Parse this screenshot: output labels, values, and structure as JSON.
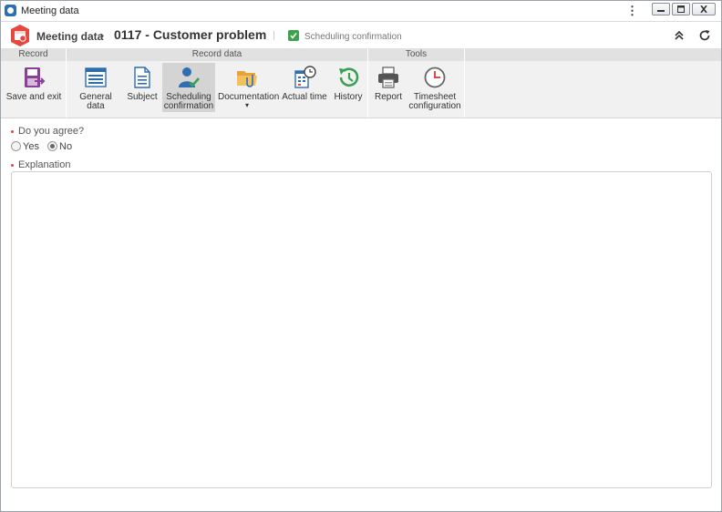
{
  "window": {
    "title": "Meeting data"
  },
  "header": {
    "module": "Meeting data",
    "separator": "›",
    "record": "0117 - Customer problem",
    "status": "Scheduling confirmation"
  },
  "ribbon": {
    "groups": [
      {
        "title": "Record"
      },
      {
        "title": "Record data"
      },
      {
        "title": "Tools"
      }
    ],
    "buttons": {
      "save_exit": {
        "line1": "Save and exit",
        "line2": ""
      },
      "general": {
        "line1": "General data",
        "line2": ""
      },
      "subject": {
        "line1": "Subject",
        "line2": ""
      },
      "scheduling": {
        "line1": "Scheduling",
        "line2": "confirmation"
      },
      "documentation": {
        "line1": "Documentation",
        "line2": "▾"
      },
      "actual_time": {
        "line1": "Actual time",
        "line2": ""
      },
      "history": {
        "line1": "History",
        "line2": ""
      },
      "report": {
        "line1": "Report",
        "line2": ""
      },
      "timesheet": {
        "line1": "Timesheet",
        "line2": "configuration"
      }
    }
  },
  "form": {
    "question_label": "Do you agree?",
    "options": [
      {
        "label": "Yes",
        "selected": false
      },
      {
        "label": "No",
        "selected": true
      }
    ],
    "explanation_label": "Explanation",
    "explanation_value": ""
  },
  "colors": {
    "accent_red": "#e5483f",
    "status_green": "#3da34a",
    "icon_blue": "#2f6db3",
    "icon_purple": "#8b3f9a",
    "icon_green": "#3aa152"
  }
}
